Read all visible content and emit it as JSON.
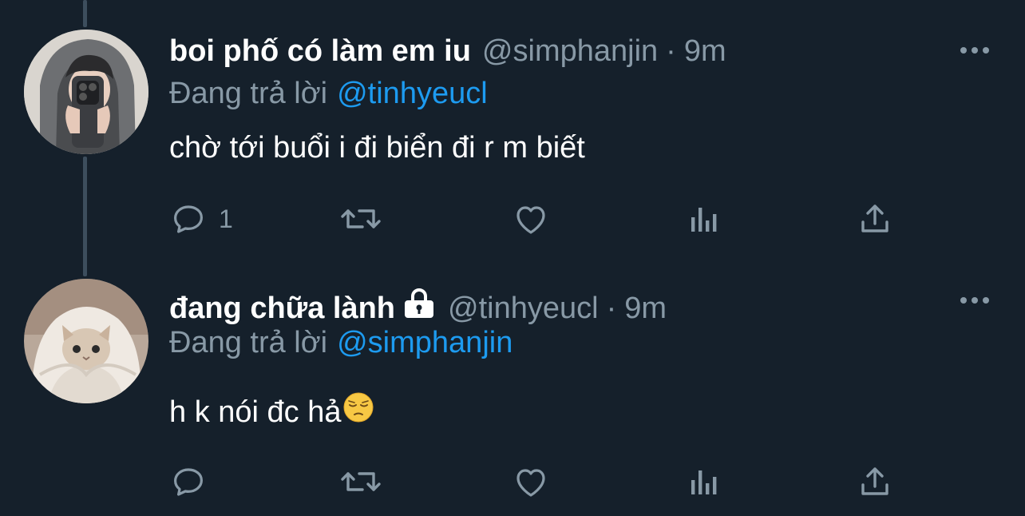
{
  "tweets": [
    {
      "display_name": "boi phố có làm em iu",
      "handle": "@simphanjin",
      "separator": "·",
      "time": "9m",
      "reply_prefix": "Đang trả lời",
      "reply_to": "@tinhyeucl",
      "text": "chờ tới buổi i đi biển đi r m biết",
      "reply_count": "1",
      "verified_lock": false
    },
    {
      "display_name": "đang chữa lành",
      "handle": "@tinhyeucl",
      "separator": "·",
      "time": "9m",
      "reply_prefix": "Đang trả lời",
      "reply_to": "@simphanjin",
      "text": "h k nói đc hả",
      "text_emoji": "pensive-face",
      "reply_count": "",
      "verified_lock": true
    }
  ],
  "icons": {
    "reply": "reply-icon",
    "retweet": "retweet-icon",
    "like": "heart-icon",
    "analytics": "analytics-icon",
    "share": "share-icon",
    "more": "more-icon",
    "lock": "lock-icon"
  },
  "colors": {
    "background": "#15202b",
    "text_primary": "#ffffff",
    "text_secondary": "#8899a6",
    "accent": "#1d9bf0",
    "thread_line": "#3d4e5d"
  }
}
